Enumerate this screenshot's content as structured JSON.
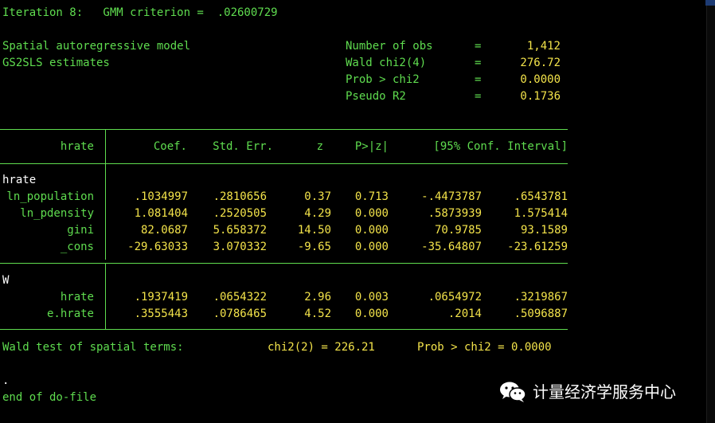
{
  "iteration": "Iteration 8:   GMM criterion =  .02600729",
  "model_title": "Spatial autoregressive model",
  "estimator": "GS2SLS estimates",
  "stats": [
    {
      "label": "Number of obs",
      "eq": "=",
      "value": "1,412"
    },
    {
      "label": "Wald chi2(4)",
      "eq": "=",
      "value": "276.72"
    },
    {
      "label": "Prob > chi2",
      "eq": "=",
      "value": "0.0000"
    },
    {
      "label": "Pseudo R2",
      "eq": "=",
      "value": "0.1736"
    }
  ],
  "table": {
    "header": {
      "depvar": "hrate",
      "coef": "Coef.",
      "se": "Std. Err.",
      "z": "z",
      "p": "P>|z|",
      "ci": "[95% Conf. Interval]"
    },
    "section1": {
      "label": "hrate",
      "rows": [
        {
          "name": "ln_population",
          "coef": ".1034997",
          "se": ".2810656",
          "z": "0.37",
          "p": "0.713",
          "lo": "-.4473787",
          "hi": ".6543781"
        },
        {
          "name": "ln_pdensity",
          "coef": "1.081404",
          "se": ".2520505",
          "z": "4.29",
          "p": "0.000",
          "lo": ".5873939",
          "hi": "1.575414"
        },
        {
          "name": "gini",
          "coef": "82.0687",
          "se": "5.658372",
          "z": "14.50",
          "p": "0.000",
          "lo": "70.9785",
          "hi": "93.1589"
        },
        {
          "name": "_cons",
          "coef": "-29.63033",
          "se": "3.070332",
          "z": "-9.65",
          "p": "0.000",
          "lo": "-35.64807",
          "hi": "-23.61259"
        }
      ]
    },
    "section2": {
      "label": "W",
      "rows": [
        {
          "name": "hrate",
          "coef": ".1937419",
          "se": ".0654322",
          "z": "2.96",
          "p": "0.003",
          "lo": ".0654972",
          "hi": ".3219867"
        },
        {
          "name": "e.hrate",
          "coef": ".3555443",
          "se": ".0786465",
          "z": "4.52",
          "p": "0.000",
          "lo": ".2014",
          "hi": ".5096887"
        }
      ]
    }
  },
  "wald_test": {
    "label": "Wald test of spatial terms:",
    "chi2": "chi2(2) = 226.21",
    "prob": "Prob > chi2 = 0.0000"
  },
  "dot": ".",
  "end_line": "end of do-file",
  "watermark": {
    "text": "计量经济学服务中心",
    "icon": "wechat-icon"
  },
  "colors": {
    "background": "#000000",
    "result_green": "#5fdc4f",
    "value_yellow": "#f3e34a",
    "text_white": "#ffffff"
  }
}
